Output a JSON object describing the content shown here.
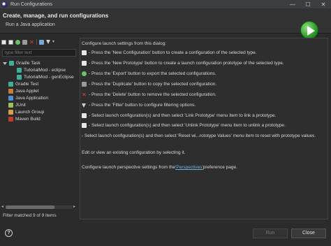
{
  "window": {
    "title": "Run Configurations",
    "controls": [
      "—",
      "☐",
      "✕"
    ]
  },
  "header": {
    "title": "Create, manage, and run configurations",
    "subtitle": "Run a Java application",
    "badge_icon": "run-badge-icon"
  },
  "toolbar": {
    "icons": [
      "new-configuration-icon",
      "new-prototype-icon",
      "export-icon",
      "duplicate-icon",
      "delete-icon",
      "collapse-all-icon",
      "filter-icon",
      "view-menu-icon"
    ]
  },
  "filter": {
    "placeholder": "type filter text"
  },
  "tree": {
    "items": [
      {
        "label": "Gradle Task",
        "level": 0,
        "expanded": true,
        "icon": "gradle-icon",
        "color": "#3fae9a"
      },
      {
        "label": "TutorialMod - eclipse",
        "level": 1,
        "icon": "gradle-task-icon",
        "color": "#3fae9a"
      },
      {
        "label": "TutorialMod - genEclipse",
        "level": 1,
        "icon": "gradle-task-icon",
        "color": "#3fae9a"
      },
      {
        "label": "Gradle Test",
        "level": 0,
        "icon": "gradle-test-icon",
        "color": "#3fae9a"
      },
      {
        "label": "Java Applet",
        "level": 0,
        "icon": "java-applet-icon",
        "color": "#c97b3a"
      },
      {
        "label": "Java Application",
        "level": 0,
        "icon": "java-application-icon",
        "color": "#4f8fd6"
      },
      {
        "label": "JUnit",
        "level": 0,
        "icon": "junit-icon",
        "color": "#9cbf5a"
      },
      {
        "label": "Launch Group",
        "level": 0,
        "icon": "launch-group-icon",
        "color": "#d6a04a"
      },
      {
        "label": "Maven Build",
        "level": 0,
        "icon": "maven-icon",
        "color": "#c0392b"
      }
    ]
  },
  "status": {
    "filter_matched": "Filter matched 9 of 9 items"
  },
  "info": {
    "intro": "Configure launch settings from this dialog:",
    "lines": [
      {
        "icon": "new-configuration-icon",
        "color": "#e8e8e8",
        "text": "- Press the 'New Configuration' button to create a configuration of the selected type."
      },
      {
        "icon": "new-prototype-icon",
        "color": "#e8e8e8",
        "text": "- Press the 'New Prototype' button to create a launch configuration prototype of the selected type."
      },
      {
        "icon": "export-icon",
        "color": "#6fbf6a",
        "text": "- Press the 'Export' button to export the selected configurations."
      },
      {
        "icon": "duplicate-icon",
        "color": "#9a9a9a",
        "text": "- Press the 'Duplicate' button to copy the selected configuration."
      },
      {
        "icon": "delete-icon",
        "color": "#d64545",
        "text": "- Press the 'Delete' button to remove the selected configuration."
      },
      {
        "icon": "filter-icon",
        "color": "#cfcfcf",
        "text": "- Press the 'Filter' button to configure filtering options."
      },
      {
        "icon": "link-prototype-icon",
        "color": "#e8e8e8",
        "text": "- Select launch configuration(s) and then select 'Link Prototype' menu item to link a prototype."
      },
      {
        "icon": "unlink-prototype-icon",
        "color": "#e8e8e8",
        "text": "- Select launch configuration(s) and then select 'Unlink Prototype' menu item to unlink a prototype."
      }
    ],
    "reset_line": "- Select launch configuration(s) and then select 'Reset wi...rototype Values' menu item to reset with prototype values.",
    "edit_line": "Edit or view an existing configuration by selecting it.",
    "perspective_pre": "Configure launch perspective settings from the ",
    "perspective_link": "'Perspectives'",
    "perspective_post": " preference page."
  },
  "buttons": {
    "help": "?",
    "run": "Run",
    "close": "Close"
  }
}
